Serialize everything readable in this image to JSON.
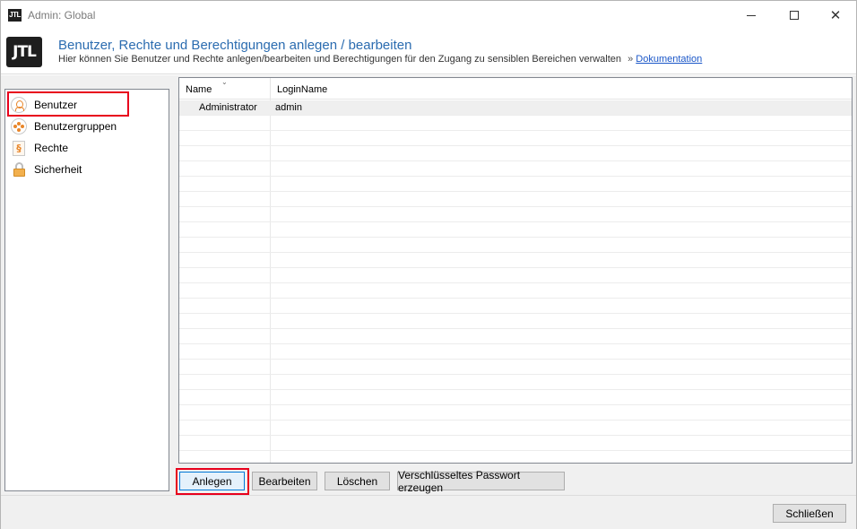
{
  "window": {
    "logo_text": "JTL",
    "title": "Admin: Global"
  },
  "header": {
    "logo_text": "JTL",
    "title": "Benutzer, Rechte und Berechtigungen anlegen / bearbeiten",
    "subtitle": "Hier können Sie Benutzer und Rechte anlegen/bearbeiten und Berechtigungen für den Zugang zu sensiblen Bereichen verwalten",
    "link_prefix": "»",
    "link_label": "Dokumentation"
  },
  "sidebar": {
    "items": [
      {
        "label": "Benutzer",
        "icon": "user-icon"
      },
      {
        "label": "Benutzergruppen",
        "icon": "user-group-icon"
      },
      {
        "label": "Rechte",
        "icon": "paragraph-icon"
      },
      {
        "label": "Sicherheit",
        "icon": "lock-icon"
      }
    ],
    "selected": "Benutzer"
  },
  "grid": {
    "columns": [
      "Name",
      "LoginName"
    ],
    "sort_indicator": "⌄",
    "rows": [
      {
        "name": "Administrator",
        "login": "admin"
      }
    ]
  },
  "actions": {
    "create_label": "Anlegen",
    "edit_label": "Bearbeiten",
    "delete_label": "Löschen",
    "password_label": "Verschlüsseltes Passwort erzeugen"
  },
  "footer": {
    "close_label": "Schließen"
  },
  "colors": {
    "accent_title": "#2b6cb0",
    "highlight": "#e8001c",
    "icon_orange": "#e8862a"
  }
}
